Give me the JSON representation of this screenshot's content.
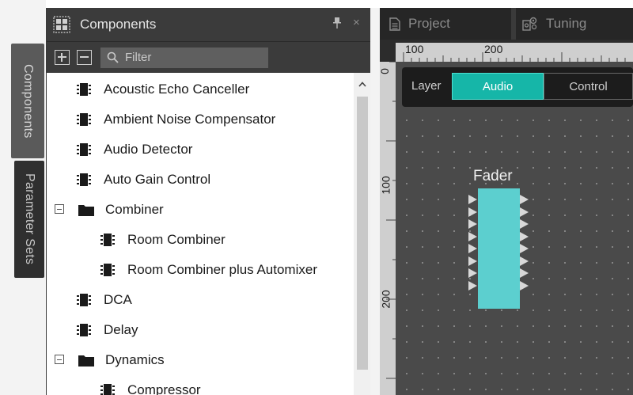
{
  "side_tabs": {
    "components": "Components",
    "parameter_sets": "Parameter Sets"
  },
  "panel": {
    "title": "Components",
    "pin_glyph": "📌",
    "close_glyph": "×",
    "filter_placeholder": "Filter",
    "items": [
      {
        "label": "Acoustic Echo Canceller",
        "kind": "component"
      },
      {
        "label": "Ambient Noise Compensator",
        "kind": "component"
      },
      {
        "label": "Audio Detector",
        "kind": "component"
      },
      {
        "label": "Auto Gain Control",
        "kind": "component"
      },
      {
        "label": "Combiner",
        "kind": "folder"
      },
      {
        "label": "Room Combiner",
        "kind": "component"
      },
      {
        "label": "Room Combiner plus Automixer",
        "kind": "component"
      },
      {
        "label": "DCA",
        "kind": "component"
      },
      {
        "label": "Delay",
        "kind": "component"
      },
      {
        "label": "Dynamics",
        "kind": "folder"
      },
      {
        "label": "Compressor",
        "kind": "component"
      }
    ]
  },
  "editor": {
    "tabs": [
      {
        "label": "Project",
        "icon": "document-icon"
      },
      {
        "label": "Tuning",
        "icon": "gears-icon"
      }
    ],
    "ruler": {
      "top_labels": [
        "100",
        "200"
      ],
      "left_labels": [
        "0",
        "100",
        "200"
      ]
    },
    "layer": {
      "label": "Layer",
      "options": [
        "Audio",
        "Control"
      ],
      "selected": "Audio"
    },
    "block": {
      "title": "Fader",
      "inputs": 8,
      "outputs": 8
    }
  },
  "colors": {
    "accent": "#16b6a8",
    "block_fill": "#5ccfcf",
    "panel_header": "#3b3b3b"
  }
}
